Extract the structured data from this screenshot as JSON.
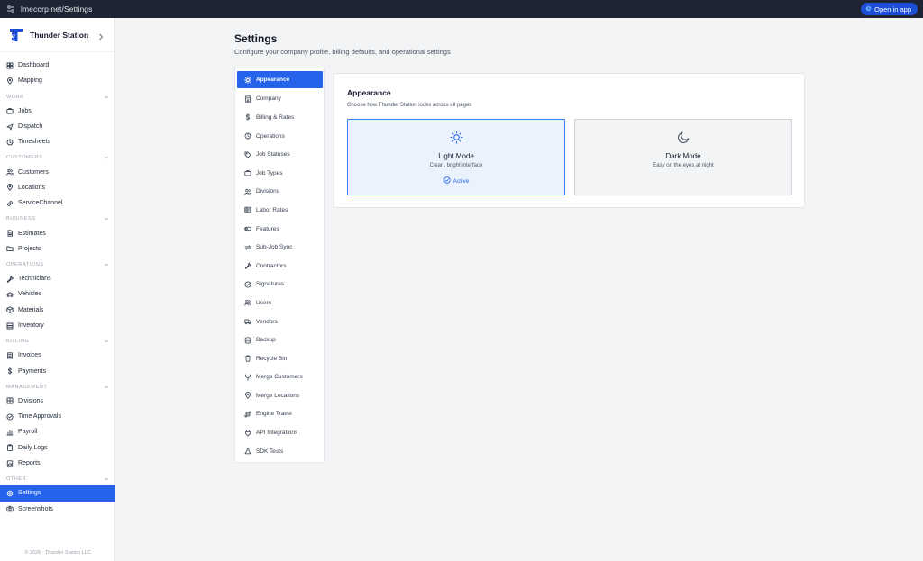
{
  "browser": {
    "url": "lmecorp.net/Settings",
    "open_in_app": "Open in app"
  },
  "sidebar": {
    "brand": "Thunder Station",
    "items": [
      {
        "type": "item",
        "label": "Dashboard",
        "icon": "dashboard-icon"
      },
      {
        "type": "item",
        "label": "Mapping",
        "icon": "map-pin-icon"
      },
      {
        "type": "section",
        "label": "WORK"
      },
      {
        "type": "item",
        "label": "Jobs",
        "icon": "briefcase-icon"
      },
      {
        "type": "item",
        "label": "Dispatch",
        "icon": "dispatch-icon"
      },
      {
        "type": "item",
        "label": "Timesheets",
        "icon": "clock-icon"
      },
      {
        "type": "section",
        "label": "CUSTOMERS"
      },
      {
        "type": "item",
        "label": "Customers",
        "icon": "users-icon"
      },
      {
        "type": "item",
        "label": "Locations",
        "icon": "map-pin-icon"
      },
      {
        "type": "item",
        "label": "ServiceChannel",
        "icon": "link-icon"
      },
      {
        "type": "section",
        "label": "BUSINESS"
      },
      {
        "type": "item",
        "label": "Estimates",
        "icon": "document-icon"
      },
      {
        "type": "item",
        "label": "Projects",
        "icon": "folder-icon"
      },
      {
        "type": "section",
        "label": "OPERATIONS"
      },
      {
        "type": "item",
        "label": "Technicians",
        "icon": "wrench-icon"
      },
      {
        "type": "item",
        "label": "Vehicles",
        "icon": "vehicle-icon"
      },
      {
        "type": "item",
        "label": "Materials",
        "icon": "box-icon"
      },
      {
        "type": "item",
        "label": "Inventory",
        "icon": "inventory-icon"
      },
      {
        "type": "section",
        "label": "BILLING"
      },
      {
        "type": "item",
        "label": "Invoices",
        "icon": "invoice-icon"
      },
      {
        "type": "item",
        "label": "Payments",
        "icon": "dollar-icon"
      },
      {
        "type": "section",
        "label": "MANAGEMENT"
      },
      {
        "type": "item",
        "label": "Divisions",
        "icon": "grid-icon"
      },
      {
        "type": "item",
        "label": "Time Approvals",
        "icon": "check-circle-icon"
      },
      {
        "type": "item",
        "label": "Payroll",
        "icon": "chart-icon"
      },
      {
        "type": "item",
        "label": "Daily Logs",
        "icon": "clipboard-icon"
      },
      {
        "type": "item",
        "label": "Reports",
        "icon": "report-icon"
      },
      {
        "type": "section",
        "label": "OTHER"
      },
      {
        "type": "item",
        "label": "Settings",
        "icon": "gear-icon",
        "active": true
      },
      {
        "type": "item",
        "label": "Screenshots",
        "icon": "camera-icon"
      }
    ],
    "copyright": "© 2026 · Thunder Station LLC"
  },
  "page": {
    "title": "Settings",
    "subtitle": "Configure your company profile, billing defaults, and operational settings"
  },
  "settings_nav": [
    {
      "label": "Appearance",
      "icon": "sun-icon",
      "active": true
    },
    {
      "label": "Company",
      "icon": "building-icon"
    },
    {
      "label": "Billing & Rates",
      "icon": "dollar-icon"
    },
    {
      "label": "Operations",
      "icon": "clock-icon"
    },
    {
      "label": "Job Statuses",
      "icon": "tag-icon"
    },
    {
      "label": "Job Types",
      "icon": "briefcase-icon"
    },
    {
      "label": "Divisions",
      "icon": "users-icon"
    },
    {
      "label": "Labor Rates",
      "icon": "table-icon"
    },
    {
      "label": "Features",
      "icon": "toggle-icon"
    },
    {
      "label": "Sub-Job Sync",
      "icon": "sync-icon"
    },
    {
      "label": "Contractors",
      "icon": "wrench-icon"
    },
    {
      "label": "Signatures",
      "icon": "check-circle-icon"
    },
    {
      "label": "Users",
      "icon": "users-icon"
    },
    {
      "label": "Vendors",
      "icon": "truck-icon"
    },
    {
      "label": "Backup",
      "icon": "database-icon"
    },
    {
      "label": "Recycle Bin",
      "icon": "trash-icon"
    },
    {
      "label": "Merge Customers",
      "icon": "merge-icon"
    },
    {
      "label": "Merge Locations",
      "icon": "map-pin-icon"
    },
    {
      "label": "Engine Travel",
      "icon": "route-icon"
    },
    {
      "label": "API Integrations",
      "icon": "plug-icon"
    },
    {
      "label": "SDK Tests",
      "icon": "flask-icon"
    }
  ],
  "appearance": {
    "title": "Appearance",
    "subtitle": "Choose how Thunder Station looks across all pages",
    "light": {
      "title": "Light Mode",
      "desc": "Clean, bright interface",
      "badge": "Active"
    },
    "dark": {
      "title": "Dark Mode",
      "desc": "Easy on the eyes at night"
    }
  },
  "colors": {
    "accent": "#2563eb",
    "topbar": "#1e2433"
  }
}
